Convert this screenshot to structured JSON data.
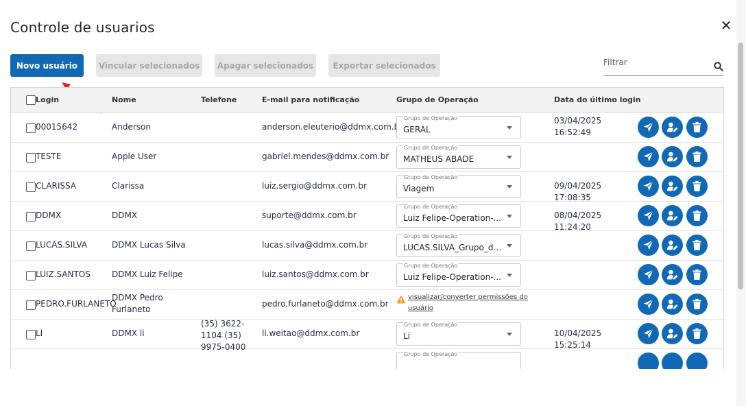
{
  "dialog": {
    "title": "Controle de usuarios",
    "close_glyph": "✕"
  },
  "toolbar": {
    "new_user": "Novo usuário",
    "link_selected": "Vincular selecionados",
    "delete_selected": "Apagar selecionados",
    "export_selected": "Exportar selecionados",
    "filter_label": "Filtrar"
  },
  "table": {
    "columns": {
      "login": "Login",
      "name": "Nome",
      "phone": "Telefone",
      "email": "E-mail para notificação",
      "group": "Grupo de Operação",
      "last_login": "Data do último login"
    },
    "group_field_label": "Grupo de Operação",
    "rows": [
      {
        "login": "00015642",
        "name": "Anderson",
        "phone": "",
        "email": "anderson.eleuterio@ddmx.com.br",
        "group": "GERAL",
        "last_login": "03/04/2025 16:52:49"
      },
      {
        "login": "TESTE",
        "name": "Apple User",
        "phone": "",
        "email": "gabriel.mendes@ddmx.com.br",
        "group": "MATHEUS ABADE",
        "last_login": ""
      },
      {
        "login": "CLARISSA",
        "name": "Clarissa",
        "phone": "",
        "email": "luiz.sergio@ddmx.com.br",
        "group": "Viagem",
        "last_login": "09/04/2025 17:08:35"
      },
      {
        "login": "DDMX",
        "name": "DDMX",
        "phone": "",
        "email": "suporte@ddmx.com.br",
        "group": "Luiz Felipe-Operation-...",
        "last_login": "08/04/2025 11:24:20"
      },
      {
        "login": "LUCAS.SILVA",
        "name": "DDMX Lucas Silva",
        "phone": "",
        "email": "lucas.silva@ddmx.com.br",
        "group": "LUCAS.SILVA_Grupo_de_...",
        "last_login": ""
      },
      {
        "login": "LUIZ.SANTOS",
        "name": "DDMX Luiz Felipe",
        "phone": "",
        "email": "luiz.santos@ddmx.com.br",
        "group": "Luiz Felipe-Operation-...",
        "last_login": ""
      },
      {
        "login": "PEDRO.FURLANETO",
        "name": "DDMX Pedro Furlaneto",
        "phone": "",
        "email": "pedro.furlaneto@ddmx.com.br",
        "group_warning": "visualizar/converter permissões do usuário",
        "last_login": ""
      },
      {
        "login": "LI",
        "name": "DDMX li",
        "phone": "(35) 3622-1104 (35) 9975-0400",
        "email": "li.weitao@ddmx.com.br",
        "group": "Li",
        "last_login": "10/04/2025 15:25:14"
      }
    ]
  },
  "colors": {
    "primary": "#1168b4",
    "disabled_bg": "#e6e6e6",
    "warning": "#f0a020",
    "annotation_arrow": "#e02020"
  },
  "icons": [
    "close-icon",
    "search-icon",
    "send-icon",
    "user-edit-icon",
    "trash-icon",
    "warning-icon",
    "arrow-annotation"
  ]
}
